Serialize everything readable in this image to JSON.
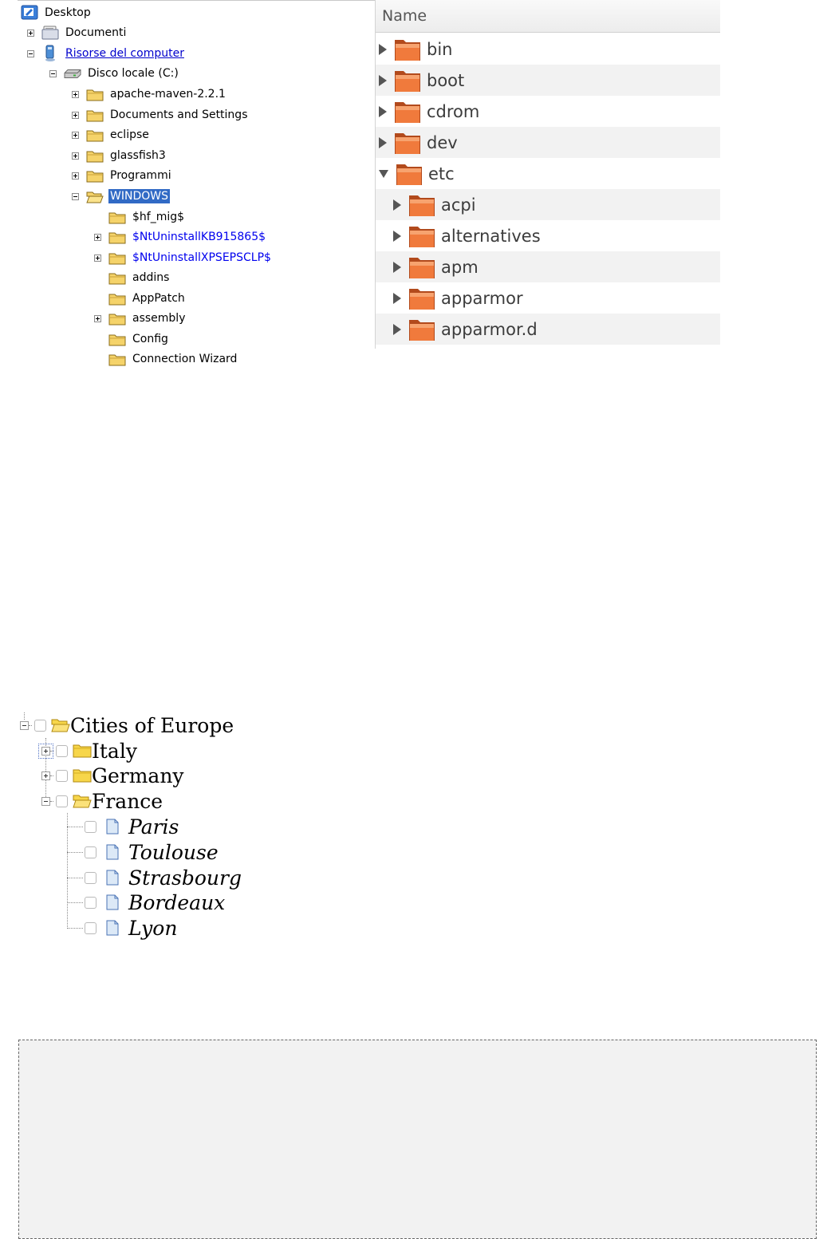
{
  "windows_tree": {
    "items": [
      {
        "label": "Desktop",
        "icon": "desktop-icon"
      },
      {
        "label": "Documenti",
        "icon": "documents-icon"
      },
      {
        "label": "Risorse del computer",
        "icon": "computer-icon"
      },
      {
        "label": "Disco locale (C:)",
        "icon": "drive-icon"
      },
      {
        "label": "apache-maven-2.2.1",
        "icon": "folder-icon"
      },
      {
        "label": "Documents and Settings",
        "icon": "folder-icon"
      },
      {
        "label": "eclipse",
        "icon": "folder-icon"
      },
      {
        "label": "glassfish3",
        "icon": "folder-icon"
      },
      {
        "label": "Programmi",
        "icon": "folder-icon"
      },
      {
        "label": "WINDOWS",
        "icon": "open-folder-icon",
        "selected": true
      },
      {
        "label": "$hf_mig$",
        "icon": "folder-icon"
      },
      {
        "label": "$NtUninstallKB915865$",
        "icon": "folder-icon"
      },
      {
        "label": "$NtUninstallXPSEPSCLP$",
        "icon": "folder-icon"
      },
      {
        "label": "addins",
        "icon": "folder-icon"
      },
      {
        "label": "AppPatch",
        "icon": "folder-icon"
      },
      {
        "label": "assembly",
        "icon": "folder-icon"
      },
      {
        "label": "Config",
        "icon": "folder-icon"
      },
      {
        "label": "Connection Wizard",
        "icon": "folder-icon"
      }
    ],
    "colors": {
      "selection": "#316ac5",
      "link": "#0000cc",
      "folder": "#f5d36a"
    }
  },
  "file_list": {
    "header": "Name",
    "rows": [
      {
        "label": "bin",
        "expanded": false
      },
      {
        "label": "boot",
        "expanded": false
      },
      {
        "label": "cdrom",
        "expanded": false
      },
      {
        "label": "dev",
        "expanded": false
      },
      {
        "label": "etc",
        "expanded": true
      },
      {
        "label": "acpi",
        "expanded": false
      },
      {
        "label": "alternatives",
        "expanded": false
      },
      {
        "label": "apm",
        "expanded": false
      },
      {
        "label": "apparmor",
        "expanded": false
      },
      {
        "label": "apparmor.d",
        "expanded": false
      }
    ],
    "colors": {
      "folder": "#e0602a",
      "stripe": "#f2f2f2"
    }
  },
  "cities_tree": {
    "root": "Cities of Europe",
    "nodes": [
      {
        "label": "Italy",
        "state": "collapsed"
      },
      {
        "label": "Germany",
        "state": "collapsed"
      },
      {
        "label": "France",
        "state": "expanded"
      }
    ],
    "leaves": [
      "Paris",
      "Toulouse",
      "Strasbourg",
      "Bordeaux",
      "Lyon"
    ],
    "colors": {
      "folder": "#f7d64a",
      "document": "#dce9f7"
    }
  }
}
